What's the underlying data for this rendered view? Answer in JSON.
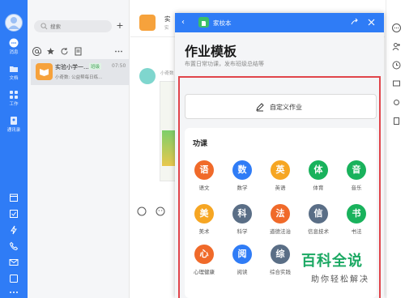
{
  "rail": {
    "avatar_text": "头像",
    "items": [
      {
        "label": "消息"
      },
      {
        "label": "文档"
      },
      {
        "label": "工作"
      },
      {
        "label": "通讯录"
      }
    ],
    "active_color": "#2f7cf6"
  },
  "conversations": {
    "search_placeholder": "搜索",
    "plus": "+",
    "items": [
      {
        "title": "实验小学一...",
        "tag": "班级",
        "time": "07:50",
        "preview": "小奇数: 公益帮每日练..."
      }
    ]
  },
  "chat_pane": {
    "title": "实",
    "subtitle": "实",
    "sender": "小奇数"
  },
  "popup": {
    "back": "‹",
    "app_name": "家校本",
    "heading": "作业模板",
    "subheading": "布置日常功课，发布班级总结等",
    "custom_button": "自定义作业",
    "course_section_title": "功课",
    "subjects": [
      {
        "char": "语",
        "name": "语文",
        "color": "#f06a2a"
      },
      {
        "char": "数",
        "name": "数学",
        "color": "#2f7cf6"
      },
      {
        "char": "英",
        "name": "英语",
        "color": "#f6a623"
      },
      {
        "char": "体",
        "name": "体育",
        "color": "#19b25c"
      },
      {
        "char": "音",
        "name": "音乐",
        "color": "#19b25c"
      },
      {
        "char": "美",
        "name": "美术",
        "color": "#f6a623"
      },
      {
        "char": "科",
        "name": "科学",
        "color": "#5a6e86"
      },
      {
        "char": "法",
        "name": "道德法治",
        "color": "#f06a2a"
      },
      {
        "char": "信",
        "name": "信息技术",
        "color": "#5a6e86"
      },
      {
        "char": "书",
        "name": "书法",
        "color": "#19b25c"
      },
      {
        "char": "心",
        "name": "心理健康",
        "color": "#f06a2a"
      },
      {
        "char": "阅",
        "name": "阅读",
        "color": "#2f7cf6"
      },
      {
        "char": "综",
        "name": "综合实践",
        "color": "#5a6e86"
      }
    ]
  },
  "watermark": {
    "logo": "百科全说",
    "subtitle": "助你轻松解决"
  }
}
